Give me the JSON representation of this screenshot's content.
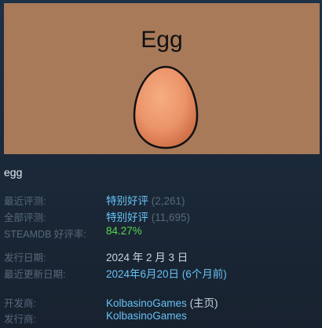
{
  "capsule": {
    "title": "Egg",
    "background_color": "#a87a5a",
    "art_icon": "egg-illustration"
  },
  "game": {
    "name": "egg"
  },
  "reviews": {
    "recent_label": "最近评测:",
    "recent_summary": "特别好评",
    "recent_count": "(2,261)",
    "all_label": "全部评测:",
    "all_summary": "特别好评",
    "all_count": "(11,695)",
    "steamdb_label": "STEAMDB 好评率:",
    "steamdb_rating": "84.27%"
  },
  "dates": {
    "release_label": "发行日期:",
    "release_value": "2024 年 2 月 3 日",
    "update_label": "最近更新日期:",
    "update_value": "2024年6月20日 (6个月前)"
  },
  "companies": {
    "developer_label": "开发商:",
    "developer_name": "KolbasinoGames",
    "developer_suffix": " (主页)",
    "publisher_label": "发行商:",
    "publisher_name": "KolbasinoGames"
  },
  "colors": {
    "page_bg": "#1b2838",
    "link_blue": "#66c0f4",
    "rating_green": "#5cd650",
    "label_grey": "#56697b"
  }
}
